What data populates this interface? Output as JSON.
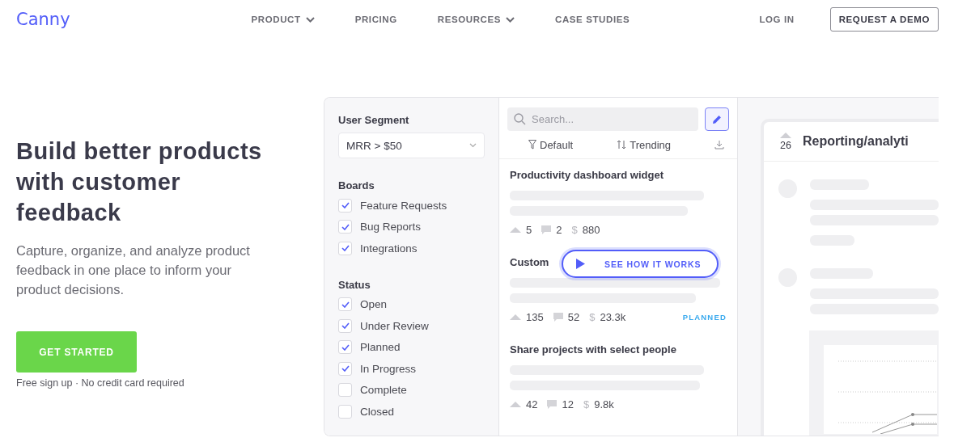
{
  "nav": {
    "logo": "Canny",
    "links": [
      {
        "label": "PRODUCT",
        "dropdown": true
      },
      {
        "label": "PRICING",
        "dropdown": false
      },
      {
        "label": "RESOURCES",
        "dropdown": true
      },
      {
        "label": "CASE STUDIES",
        "dropdown": false
      }
    ],
    "login": "LOG IN",
    "demo_button": "REQUEST A DEMO"
  },
  "hero": {
    "title": "Build better products with customer feedback",
    "subtitle": "Capture, organize, and analyze product feedback in one place to inform your product decisions.",
    "cta": "GET STARTED",
    "note": "Free sign up · No credit card required"
  },
  "demo": {
    "filters": {
      "segment_label": "User Segment",
      "segment_value": "MRR > $50",
      "groups": [
        {
          "title": "Boards",
          "items": [
            {
              "label": "Feature Requests",
              "checked": true
            },
            {
              "label": "Bug Reports",
              "checked": true
            },
            {
              "label": "Integrations",
              "checked": true
            }
          ]
        },
        {
          "title": "Status",
          "items": [
            {
              "label": "Open",
              "checked": true
            },
            {
              "label": "Under Review",
              "checked": true
            },
            {
              "label": "Planned",
              "checked": true
            },
            {
              "label": "In Progress",
              "checked": true
            },
            {
              "label": "Complete",
              "checked": false
            },
            {
              "label": "Closed",
              "checked": false
            }
          ]
        }
      ]
    },
    "list": {
      "search_placeholder": "Search...",
      "filter": "Default",
      "sort": "Trending",
      "posts": [
        {
          "title": "Productivity dashboard widget",
          "votes": "5",
          "comments": "2",
          "currency": "$",
          "mrr": "880"
        },
        {
          "title": "Custom",
          "votes": "135",
          "comments": "52",
          "currency": "$",
          "mrr": "23.3k",
          "status": "PLANNED"
        },
        {
          "title": "Share projects with select people",
          "votes": "42",
          "comments": "12",
          "currency": "$",
          "mrr": "9.8k"
        }
      ]
    },
    "video_button": "SEE HOW IT WORKS",
    "detail": {
      "votes": "26",
      "title": "Reporting/analyti"
    }
  }
}
